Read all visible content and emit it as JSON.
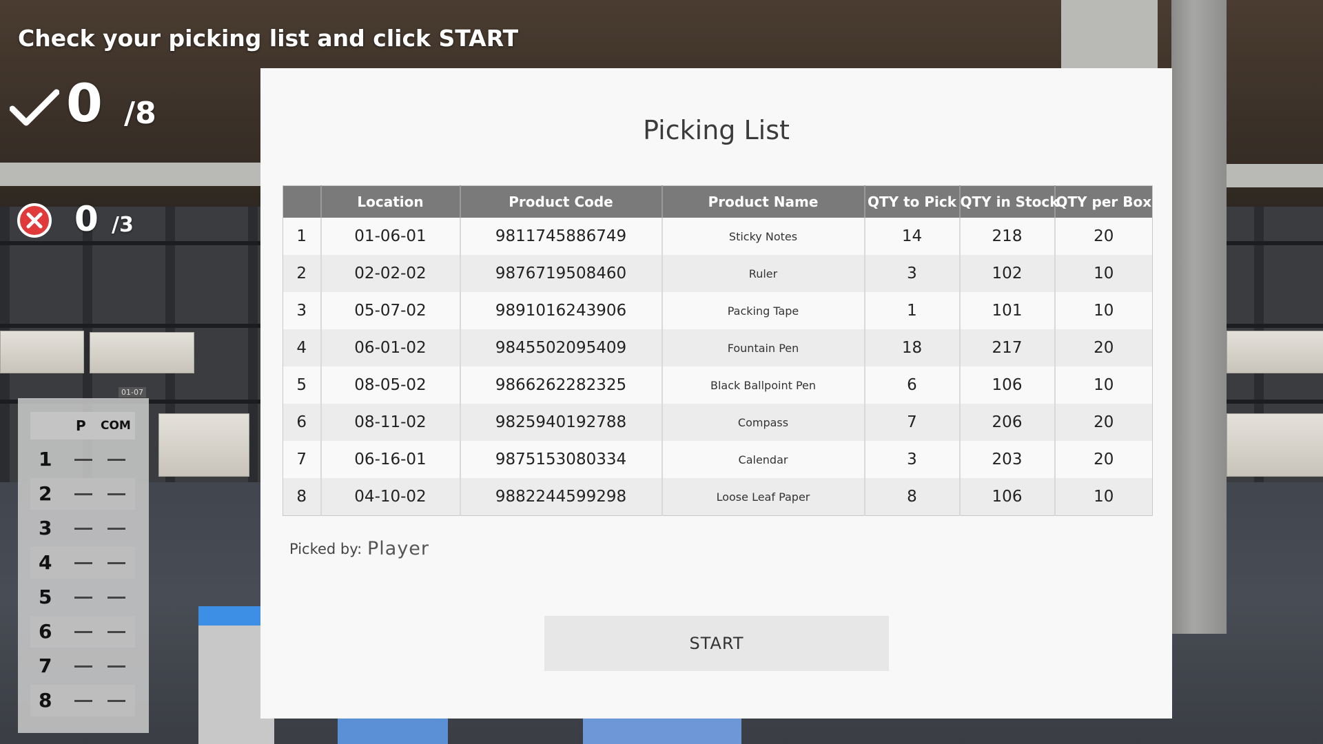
{
  "hud": {
    "instruction": "Check your picking list and click START",
    "correct": {
      "value": "0",
      "total": "/8"
    },
    "errors": {
      "value": "0",
      "total": "/3"
    }
  },
  "checklist": {
    "location_tag": "01-07",
    "headers": [
      "P",
      "COM"
    ],
    "rows": [
      "1",
      "2",
      "3",
      "4",
      "5",
      "6",
      "7",
      "8"
    ]
  },
  "picking_list": {
    "title": "Picking List",
    "columns": [
      "",
      "Location",
      "Product Code",
      "Product Name",
      "QTY to Pick",
      "QTY in Stock",
      "QTY per Box"
    ],
    "rows": [
      [
        "1",
        "01-06-01",
        "9811745886749",
        "Sticky Notes",
        "14",
        "218",
        "20"
      ],
      [
        "2",
        "02-02-02",
        "9876719508460",
        "Ruler",
        "3",
        "102",
        "10"
      ],
      [
        "3",
        "05-07-02",
        "9891016243906",
        "Packing Tape",
        "1",
        "101",
        "10"
      ],
      [
        "4",
        "06-01-02",
        "9845502095409",
        "Fountain Pen",
        "18",
        "217",
        "20"
      ],
      [
        "5",
        "08-05-02",
        "9866262282325",
        "Black Ballpoint Pen",
        "6",
        "106",
        "10"
      ],
      [
        "6",
        "08-11-02",
        "9825940192788",
        "Compass",
        "7",
        "206",
        "20"
      ],
      [
        "7",
        "06-16-01",
        "9875153080334",
        "Calendar",
        "3",
        "203",
        "20"
      ],
      [
        "8",
        "04-10-02",
        "9882244599298",
        "Loose Leaf Paper",
        "8",
        "106",
        "10"
      ]
    ],
    "picked_by_label": "Picked by:",
    "picked_by_value": "Player",
    "start_label": "START"
  },
  "colors": {
    "header_bg": "#7a7a7a",
    "modal_bg": "#f8f8f8",
    "row_alt": "#ececec",
    "error_red": "#e03a3a"
  }
}
